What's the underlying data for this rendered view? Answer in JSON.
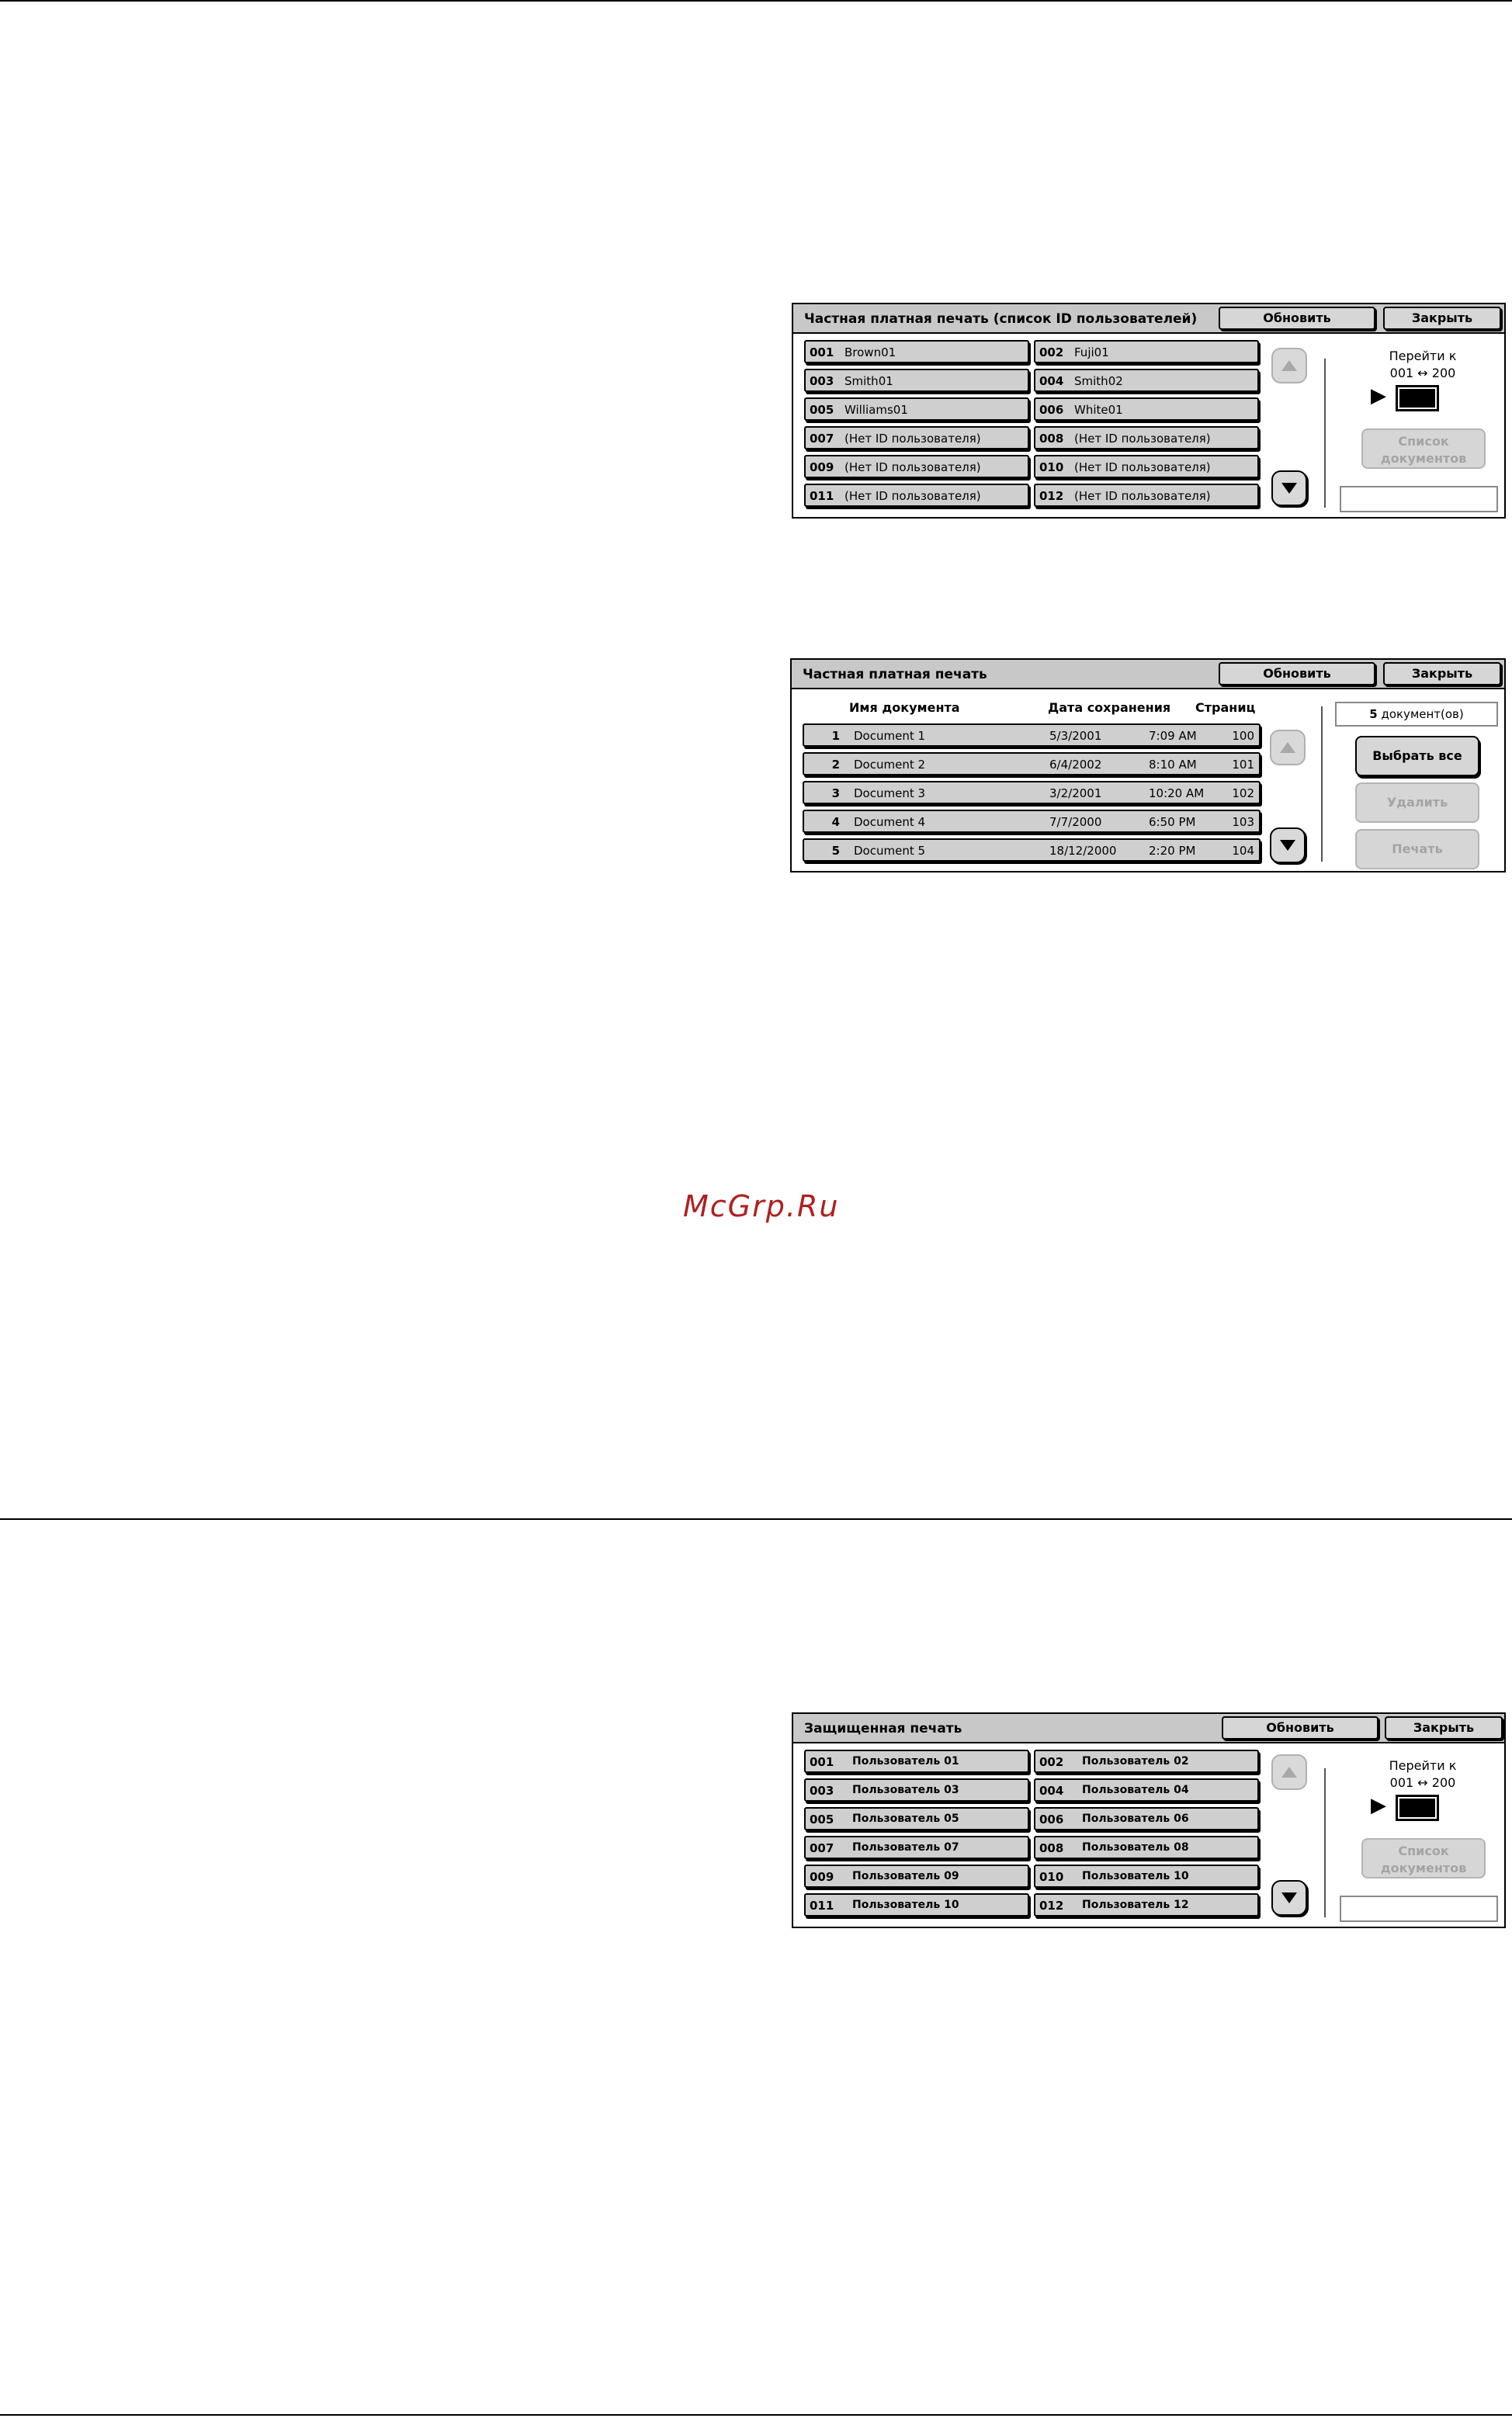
{
  "panel1": {
    "title": "Частная платная печать (список ID пользователей)",
    "refresh_label": "Обновить",
    "close_label": "Закрыть",
    "users": [
      {
        "num": "001",
        "name": "Brown01"
      },
      {
        "num": "002",
        "name": "Fuji01"
      },
      {
        "num": "003",
        "name": "Smith01"
      },
      {
        "num": "004",
        "name": "Smith02"
      },
      {
        "num": "005",
        "name": "Williams01"
      },
      {
        "num": "006",
        "name": "White01"
      },
      {
        "num": "007",
        "name": "(Нет ID пользователя)"
      },
      {
        "num": "008",
        "name": "(Нет ID пользователя)"
      },
      {
        "num": "009",
        "name": "(Нет ID пользователя)"
      },
      {
        "num": "010",
        "name": "(Нет ID пользователя)"
      },
      {
        "num": "011",
        "name": "(Нет ID пользователя)"
      },
      {
        "num": "012",
        "name": "(Нет ID пользователя)"
      }
    ],
    "goto_label": "Перейти к",
    "goto_range": "001 ↔ 200",
    "doc_list_label_1": "Список",
    "doc_list_label_2": "документов"
  },
  "panel2": {
    "title": "Частная платная печать",
    "refresh_label": "Обновить",
    "close_label": "Закрыть",
    "headers": {
      "name": "Имя документа",
      "date": "Дата сохранения",
      "pages": "Страниц"
    },
    "documents": [
      {
        "idx": "1",
        "name": "Document 1",
        "date": "5/3/2001",
        "time": "7:09 AM",
        "pages": "100"
      },
      {
        "idx": "2",
        "name": "Document 2",
        "date": "6/4/2002",
        "time": "8:10 AM",
        "pages": "101"
      },
      {
        "idx": "3",
        "name": "Document 3",
        "date": "3/2/2001",
        "time": "10:20 AM",
        "pages": "102"
      },
      {
        "idx": "4",
        "name": "Document 4",
        "date": "7/7/2000",
        "time": "6:50 PM",
        "pages": "103"
      },
      {
        "idx": "5",
        "name": "Document 5",
        "date": "18/12/2000",
        "time": "2:20 PM",
        "pages": "104"
      }
    ],
    "doc_count": "5",
    "doc_count_unit": "документ(ов)",
    "select_all_label": "Выбрать все",
    "delete_label": "Удалить",
    "print_label": "Печать"
  },
  "panel3": {
    "title": "Защищенная печать",
    "refresh_label": "Обновить",
    "close_label": "Закрыть",
    "users": [
      {
        "num": "001",
        "name": "Пользователь 01"
      },
      {
        "num": "002",
        "name": "Пользователь 02"
      },
      {
        "num": "003",
        "name": "Пользователь 03"
      },
      {
        "num": "004",
        "name": "Пользователь 04"
      },
      {
        "num": "005",
        "name": "Пользователь 05"
      },
      {
        "num": "006",
        "name": "Пользователь 06"
      },
      {
        "num": "007",
        "name": "Пользователь 07"
      },
      {
        "num": "008",
        "name": "Пользователь 08"
      },
      {
        "num": "009",
        "name": "Пользователь 09"
      },
      {
        "num": "010",
        "name": "Пользователь 10"
      },
      {
        "num": "011",
        "name": "Пользователь 10"
      },
      {
        "num": "012",
        "name": "Пользователь 12"
      }
    ],
    "goto_label": "Перейти к",
    "goto_range": "001 ↔ 200",
    "doc_list_label_1": "Список",
    "doc_list_label_2": "документов"
  },
  "watermark": "McGrp.Ru"
}
